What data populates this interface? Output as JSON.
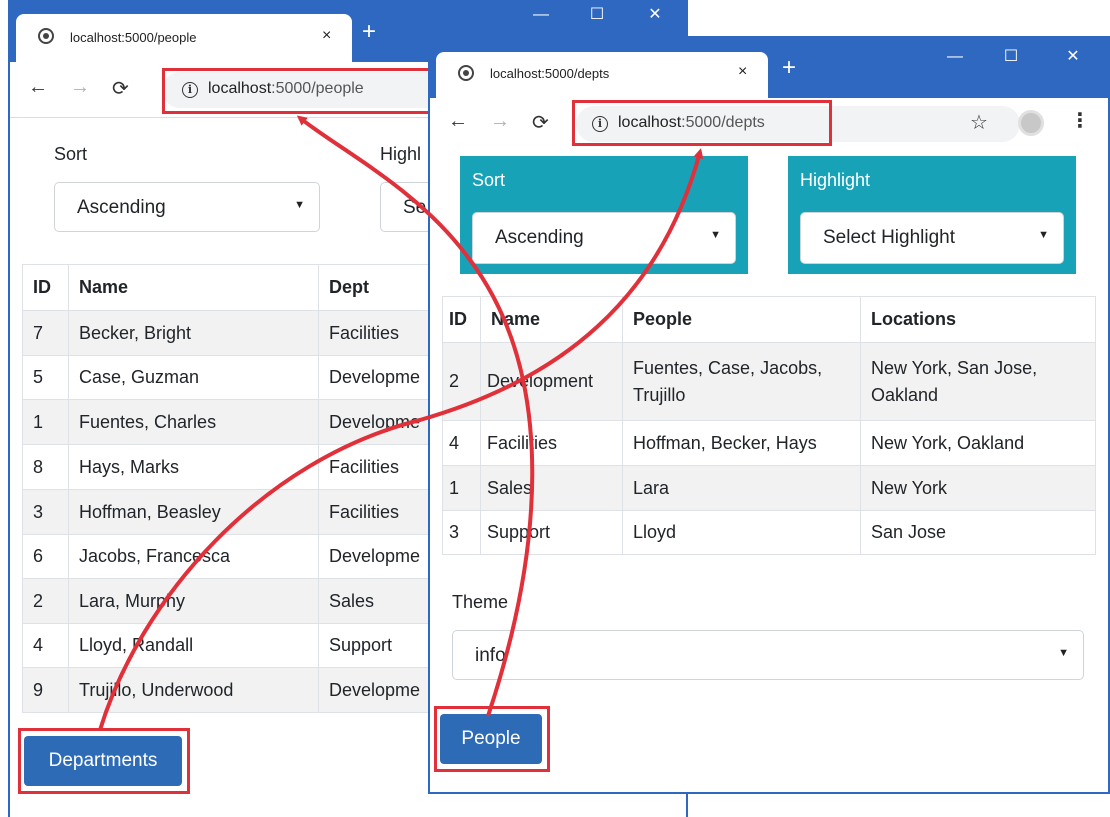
{
  "people_window": {
    "tab_title": "localhost:5000/people",
    "tab_close": "×",
    "new_tab": "+",
    "url_host": "localhost",
    "url_rest": ":5000/people",
    "sort": {
      "label": "Sort",
      "value": "Ascending"
    },
    "highlight": {
      "label": "Highl",
      "value": "Se"
    },
    "table": {
      "headers": [
        "ID",
        "Name",
        "Dept"
      ],
      "rows": [
        [
          "7",
          "Becker, Bright",
          "Facilities"
        ],
        [
          "5",
          "Case, Guzman",
          "Developme"
        ],
        [
          "1",
          "Fuentes, Charles",
          "Developme"
        ],
        [
          "8",
          "Hays, Marks",
          "Facilities"
        ],
        [
          "3",
          "Hoffman, Beasley",
          "Facilities"
        ],
        [
          "6",
          "Jacobs, Francesca",
          "Developme"
        ],
        [
          "2",
          "Lara, Murphy",
          "Sales"
        ],
        [
          "4",
          "Lloyd, Randall",
          "Support"
        ],
        [
          "9",
          "Trujillo, Underwood",
          "Developme"
        ]
      ]
    },
    "button_label": "Departments"
  },
  "depts_window": {
    "tab_title": "localhost:5000/depts",
    "tab_close": "×",
    "new_tab": "+",
    "url_host": "localhost",
    "url_rest": ":5000/depts",
    "sort": {
      "label": "Sort",
      "value": "Ascending"
    },
    "highlight": {
      "label": "Highlight",
      "value": "Select Highlight"
    },
    "table": {
      "headers": [
        "ID",
        "Name",
        "People",
        "Locations"
      ],
      "rows": [
        [
          "2",
          "Development",
          "Fuentes, Case, Jacobs, Trujillo",
          "New York, San Jose, Oakland"
        ],
        [
          "4",
          "Facilities",
          "Hoffman, Becker, Hays",
          "New York, Oakland"
        ],
        [
          "1",
          "Sales",
          "Lara",
          "New York"
        ],
        [
          "3",
          "Support",
          "Lloyd",
          "San Jose"
        ]
      ]
    },
    "theme": {
      "label": "Theme",
      "value": "info"
    },
    "button_label": "People"
  },
  "colors": {
    "titlebar": "#2f68c0",
    "highlight_box": "#e0303a",
    "button": "#2d6bb7",
    "panel": "#17a2b8"
  }
}
